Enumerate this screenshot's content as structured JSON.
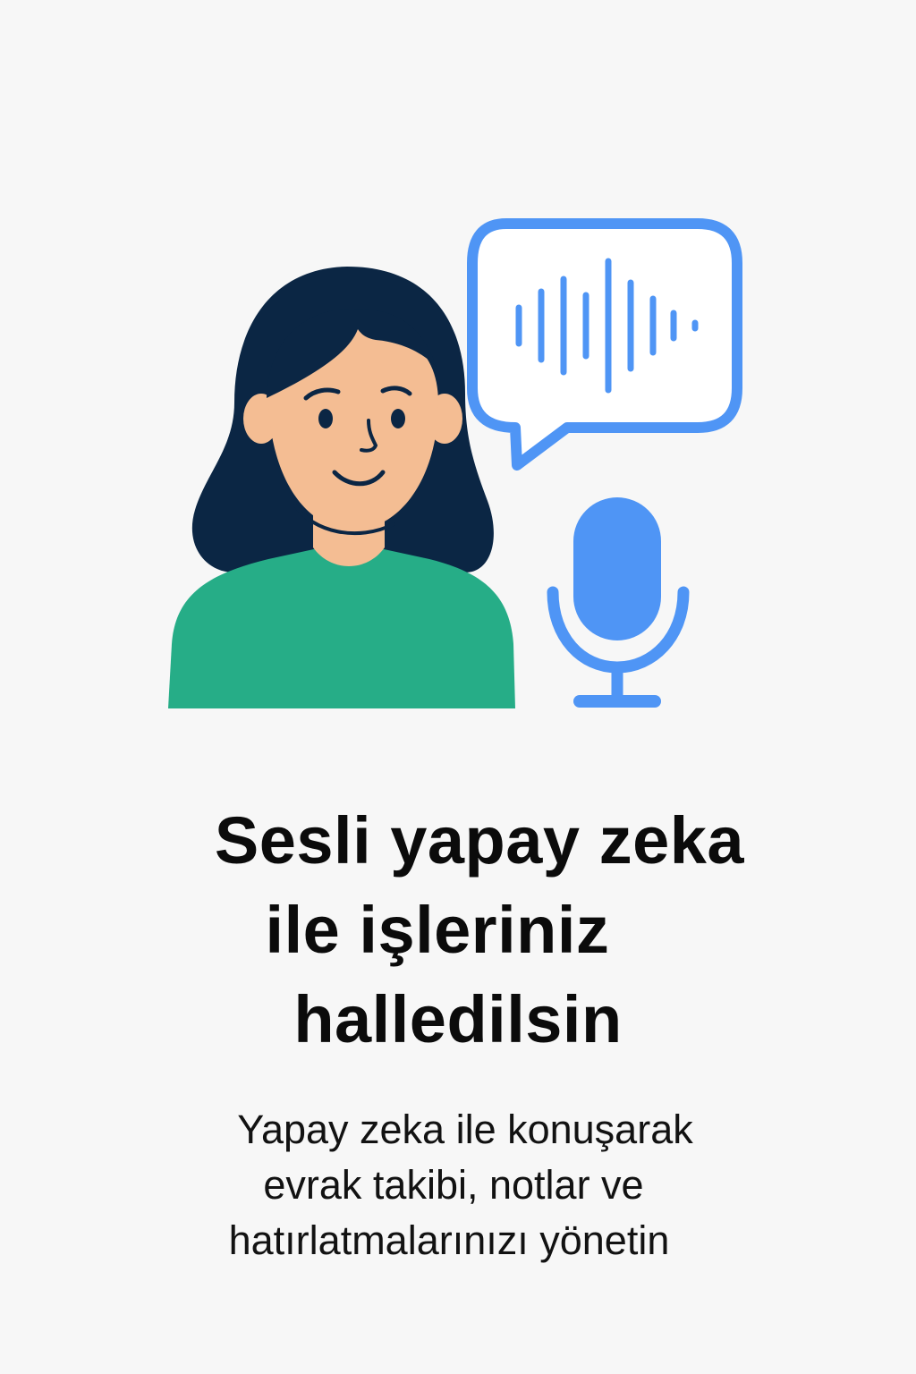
{
  "onboarding": {
    "title_lines": [
      "Sesli yapay zeka",
      "ile işleriniz",
      "halledilsin"
    ],
    "subtitle_lines": [
      "Yapay zeka ile konuşarak",
      "evrak takibi, notlar ve",
      "hatırlatmalarınızı yönetin"
    ]
  },
  "colors": {
    "background": "#f7f7f7",
    "hair": "#0b2644",
    "skin": "#f4bd93",
    "shirt": "#26ad87",
    "accent_blue": "#4f95f5",
    "text": "#0b0b0b"
  },
  "icons": [
    "person-avatar-icon",
    "speech-bubble-icon",
    "sound-wave-icon",
    "microphone-icon"
  ]
}
